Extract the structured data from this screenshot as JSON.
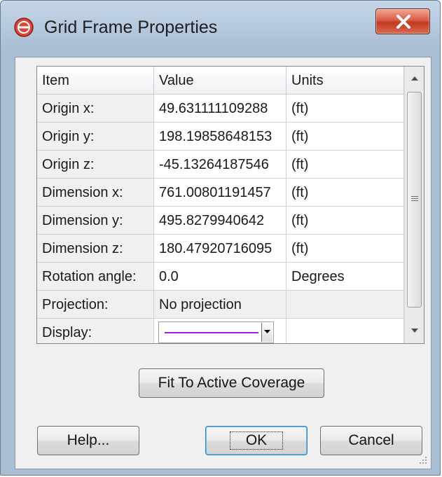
{
  "window": {
    "title": "Grid Frame Properties"
  },
  "colors": {
    "display_line": "#a61ed6",
    "close_button": "#c94a35",
    "icon": "#d9473a"
  },
  "icons": {
    "app": "red-circle-icon",
    "close": "close-icon",
    "scroll_up": "arrow-up-icon",
    "scroll_down": "arrow-down-icon",
    "combo": "chevron-down-icon"
  },
  "grid": {
    "headers": {
      "item": "Item",
      "value": "Value",
      "units": "Units"
    },
    "rows": [
      {
        "item": "Origin x:",
        "value": "49.631111109288",
        "units": "(ft)"
      },
      {
        "item": "Origin y:",
        "value": "198.19858648153",
        "units": "(ft)"
      },
      {
        "item": "Origin z:",
        "value": "-45.13264187546",
        "units": "(ft)"
      },
      {
        "item": "Dimension x:",
        "value": "761.00801191457",
        "units": "(ft)"
      },
      {
        "item": "Dimension y:",
        "value": "495.8279940642",
        "units": "(ft)"
      },
      {
        "item": "Dimension z:",
        "value": "180.47920716095",
        "units": "(ft)"
      },
      {
        "item": "Rotation angle:",
        "value": "0.0",
        "units": "Degrees"
      },
      {
        "item": "Projection:",
        "value": "No projection",
        "units": ""
      },
      {
        "item": "Display:",
        "value": "",
        "units": ""
      }
    ]
  },
  "buttons": {
    "fit": "Fit To Active Coverage",
    "help": "Help...",
    "ok": "OK",
    "cancel": "Cancel"
  }
}
